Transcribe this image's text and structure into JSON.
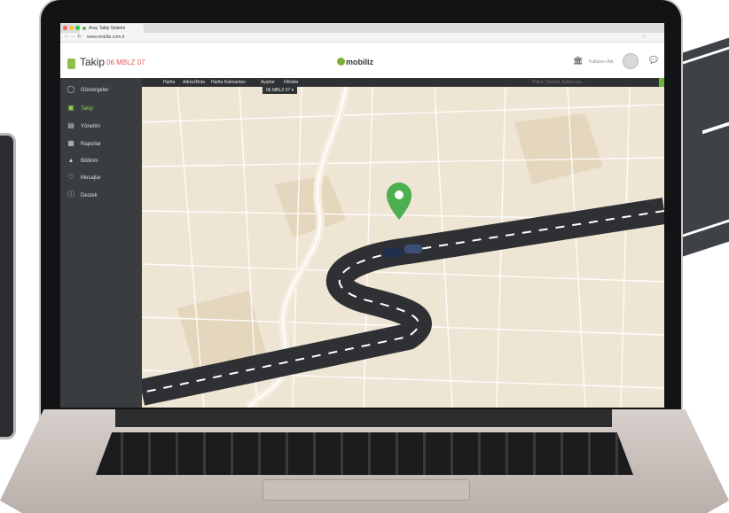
{
  "browser": {
    "tab_title": "Araç Takip Sistemi",
    "url": "www.mobiliz.com.tr",
    "traffic_colors": [
      "#ff5f57",
      "#ffbd2e",
      "#28c940"
    ]
  },
  "app": {
    "title": "Takip",
    "plate": "06 MBLZ 07",
    "brand": "mobiliz",
    "user_name": "Kullanıcı Adı",
    "accent_color": "#8fd14f"
  },
  "sidebar": {
    "items": [
      {
        "label": "Göstergeler",
        "icon": "gauge-icon",
        "active": false
      },
      {
        "label": "Takip",
        "icon": "map-icon",
        "active": true
      },
      {
        "label": "Yönetim",
        "icon": "truck-icon",
        "active": false
      },
      {
        "label": "Raporlar",
        "icon": "report-icon",
        "active": false
      },
      {
        "label": "Bildirim",
        "icon": "bell-icon",
        "active": false
      },
      {
        "label": "Mesajlar",
        "icon": "message-icon",
        "active": false
      },
      {
        "label": "Destek",
        "icon": "info-icon",
        "active": false
      }
    ]
  },
  "menubar": {
    "items": [
      "Harita",
      "Adres/Rota",
      "Harita Katmanları",
      "Ayarlar",
      "Filtreler"
    ],
    "search_placeholder": "Plaka, Sürücü, Adres ara..."
  },
  "map": {
    "vehicle_label": "06 MBLZ 07",
    "pin_color": "#4caf50",
    "road_color": "#2e3033",
    "land_color": "#efe5d4"
  }
}
